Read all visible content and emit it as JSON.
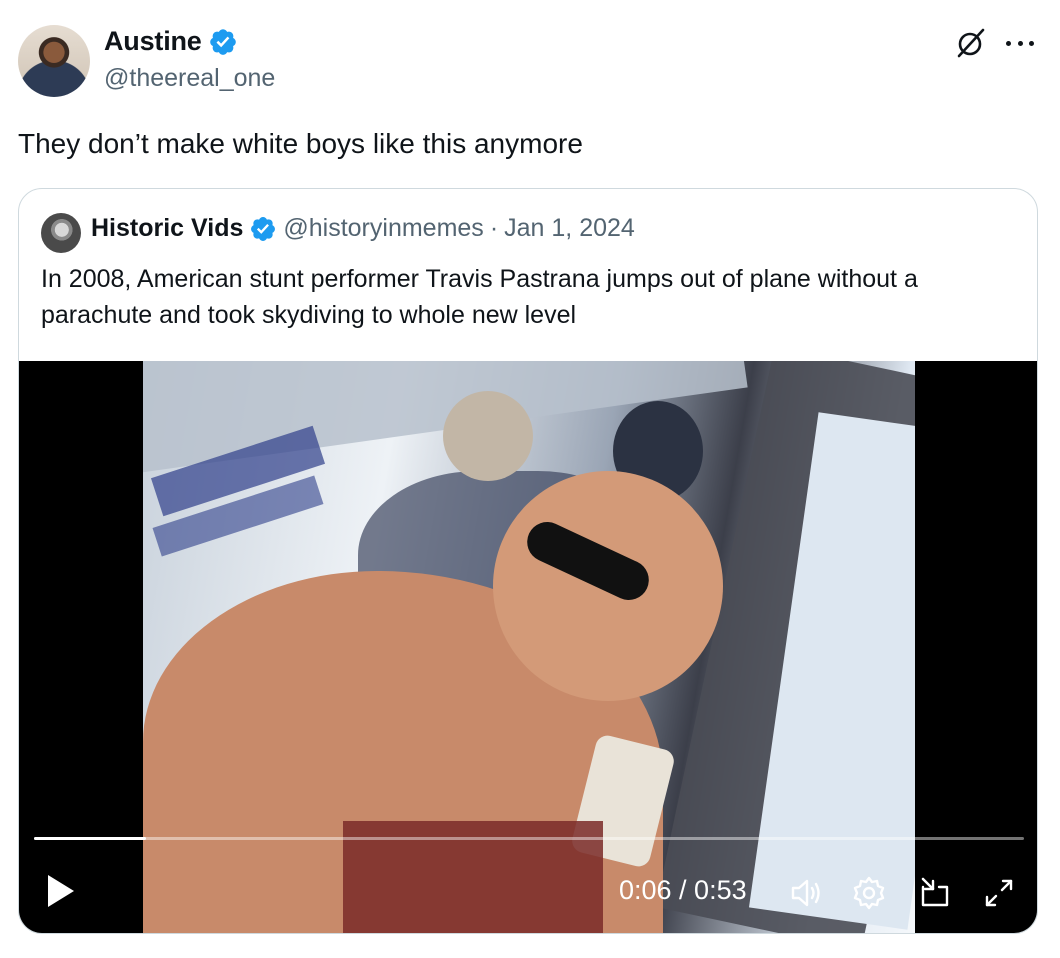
{
  "author": {
    "name": "Austine",
    "handle": "@theereal_one",
    "verified": true
  },
  "tweet": {
    "text": "They don’t make white boys like this anymore"
  },
  "header_icons": [
    "grok-icon",
    "more-icon"
  ],
  "quoted": {
    "name": "Historic Vids",
    "handle": "@historyinmemes",
    "separator": "·",
    "date": "Jan 1, 2024",
    "verified": true,
    "text": "In 2008, American stunt performer Travis Pastrana jumps out of plane without a parachute and took skydiving to whole new level"
  },
  "video": {
    "current_time": "0:06",
    "duration": "0:53",
    "time_label": "0:06 / 0:53",
    "progress_fraction": 0.113,
    "controls": [
      "play-icon",
      "volume-icon",
      "settings-icon",
      "picture-in-picture-icon",
      "fullscreen-icon"
    ]
  },
  "colors": {
    "text_primary": "#0f1419",
    "text_secondary": "#536471",
    "verified_blue": "#1d9bf0",
    "card_border": "#cfd9de"
  }
}
